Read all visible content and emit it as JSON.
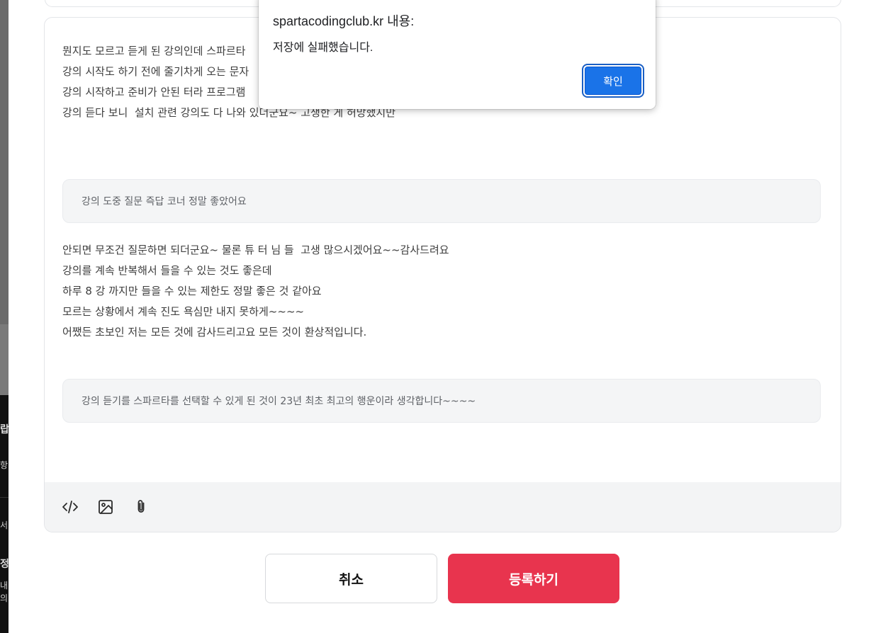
{
  "background_fragments": {
    "glyph_1": "랍",
    "glyph_2": "항",
    "glyph_3": "서",
    "glyph_4": "정",
    "glyph_5": "내",
    "glyph_6": "의"
  },
  "editor": {
    "paragraph_1": [
      "뭔지도 모르고 듣게 된 강의인데 스파르타",
      "강의 시작도 하기 전에 줄기차게 오는 문자",
      "강의 시작하고 준비가 안된 터라 프로그램",
      "강의 듣다 보니  설치 관련 강의도 다 나와 있더군요~ 고생한 게 허망했지만"
    ],
    "quote_1": "강의 도중 질문 즉답 코너 정말 좋았어요",
    "paragraph_2": [
      "안되면 무조건 질문하면 되더군요~ 물론 튜 터 님 들  고생 많으시겠어요~~감사드려요",
      "강의를 계속 반복해서 들을 수 있는 것도 좋은데",
      "하루 8 강 까지만 들을 수 있는 제한도 정말 좋은 것 같아요",
      "모르는 상황에서 계속 진도 욕심만 내지 못하게~~~~",
      "어쨌든 초보인 저는 모든 것에 감사드리고요 모든 것이 환상적입니다."
    ],
    "quote_2": "강의 듣기를 스파르타를 선택할 수 있게 된 것이 23년 최초 최고의 행운이라 생각합니다~~~~",
    "toolbar": {
      "code_icon": "code-icon",
      "image_icon": "image-icon",
      "attach_icon": "paperclip-icon"
    }
  },
  "actions": {
    "cancel_label": "취소",
    "submit_label": "등록하기"
  },
  "alert": {
    "title": "spartacodingclub.kr 내용:",
    "message": "저장에 실패했습니다.",
    "ok_label": "확인"
  },
  "colors": {
    "submit": "#e8344e",
    "alert_button": "#1a73e8",
    "quote_bg": "#f4f5f6",
    "toolbar_bg": "#f3f4f5"
  }
}
